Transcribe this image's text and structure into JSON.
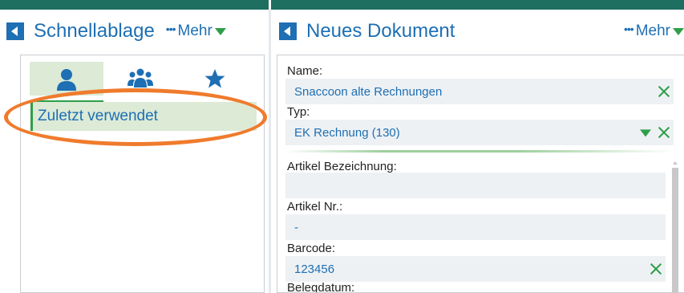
{
  "left": {
    "title": "Schnellablage",
    "more_label": "Mehr",
    "tabs": [
      "person-tab",
      "group-tab",
      "favorites-tab"
    ],
    "recent_label": "Zuletzt verwendet"
  },
  "right": {
    "title": "Neues Dokument",
    "more_label": "Mehr",
    "fields": {
      "name_label": "Name:",
      "name_value": "Snaccoon alte Rechnungen",
      "typ_label": "Typ:",
      "typ_value": "EK Rechnung (130)",
      "artikel_bez_label": "Artikel Bezeichnung:",
      "artikel_bez_value": "",
      "artikel_nr_label": "Artikel Nr.:",
      "artikel_nr_value": "-",
      "barcode_label": "Barcode:",
      "barcode_value": "123456",
      "belegdatum_label": "Belegdatum:"
    }
  },
  "colors": {
    "accent_blue": "#1e6fb3",
    "accent_green": "#2f9e4a",
    "highlight_orange": "#ef7b2d",
    "tab_active_bg": "#dcead6",
    "field_bg": "#eef1f4"
  }
}
